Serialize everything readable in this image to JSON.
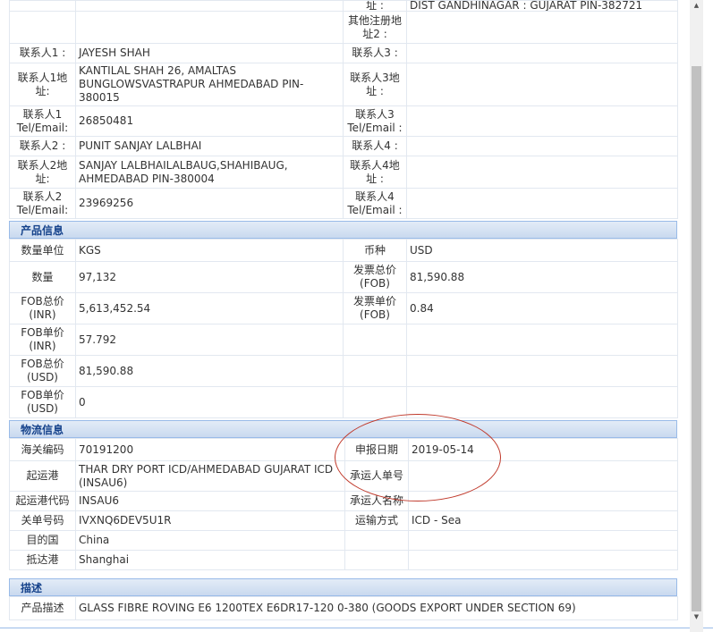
{
  "contact_section": {
    "top_row": {
      "right_label": "址 :",
      "right_value": "DIST GANDHINAGAR : GUJARAT PIN-382721"
    },
    "rows": [
      {
        "l_label": "",
        "l_value": "",
        "r_label": "其他注册地址2 :",
        "r_value": ""
      },
      {
        "l_label": "联系人1 :",
        "l_value": "JAYESH SHAH",
        "r_label": "联系人3 :",
        "r_value": ""
      },
      {
        "l_label": "联系人1地址:",
        "l_value": "KANTILAL SHAH 26, AMALTAS BUNGLOWSVASTRAPUR AHMEDABAD PIN-380015",
        "r_label": "联系人3地址 :",
        "r_value": ""
      },
      {
        "l_label": "联系人1 Tel/Email:",
        "l_value": "26850481",
        "r_label": "联系人3 Tel/Email :",
        "r_value": ""
      },
      {
        "l_label": "联系人2 :",
        "l_value": "PUNIT SANJAY LALBHAI",
        "r_label": "联系人4 :",
        "r_value": ""
      },
      {
        "l_label": "联系人2地址:",
        "l_value": "SANJAY LALBHAILALBAUG,SHAHIBAUG, AHMEDABAD PIN-380004",
        "r_label": "联系人4地址 :",
        "r_value": ""
      },
      {
        "l_label": "联系人2 Tel/Email:",
        "l_value": "23969256",
        "r_label": "联系人4 Tel/Email :",
        "r_value": ""
      }
    ]
  },
  "product_section": {
    "title": "产品信息",
    "rows": [
      {
        "l_label": "数量单位",
        "l_value": "KGS",
        "r_label": "币种",
        "r_value": "USD"
      },
      {
        "l_label": "数量",
        "l_value": "97,132",
        "r_label": "发票总价(FOB)",
        "r_value": "81,590.88"
      },
      {
        "l_label": "FOB总价(INR)",
        "l_value": "5,613,452.54",
        "r_label": "发票单价(FOB)",
        "r_value": "0.84"
      },
      {
        "l_label": "FOB单价(INR)",
        "l_value": "57.792",
        "r_label": "",
        "r_value": ""
      },
      {
        "l_label": "FOB总价(USD)",
        "l_value": "81,590.88",
        "r_label": "",
        "r_value": ""
      },
      {
        "l_label": "FOB单价(USD)",
        "l_value": "0",
        "r_label": "",
        "r_value": ""
      }
    ]
  },
  "logistics_section": {
    "title": "物流信息",
    "rows": [
      {
        "l_label": "海关编码",
        "l_value": "70191200",
        "r_label": "申报日期",
        "r_value": "2019-05-14"
      },
      {
        "l_label": "起运港",
        "l_value": "THAR DRY PORT ICD/AHMEDABAD GUJARAT ICD (INSAU6)",
        "r_label": "承运人单号",
        "r_value": ""
      },
      {
        "l_label": "起运港代码",
        "l_value": "INSAU6",
        "r_label": "承运人名称",
        "r_value": ""
      },
      {
        "l_label": "关单号码",
        "l_value": "IVXNQ6DEV5U1R",
        "r_label": "运输方式",
        "r_value": "ICD - Sea"
      },
      {
        "l_label": "目的国",
        "l_value": "China",
        "r_label": "",
        "r_value": ""
      },
      {
        "l_label": "抵达港",
        "l_value": "Shanghai",
        "r_label": "",
        "r_value": ""
      }
    ]
  },
  "description_section": {
    "title": "描述",
    "label": "产品描述",
    "value": "GLASS FIBRE ROVING E6 1200TEX E6DR17-120 0-380 (GOODS EXPORT UNDER SECTION 69)"
  },
  "annotation": {
    "color": "#c0392b"
  },
  "scrollbar": {
    "up_icon": "chevron-up-icon",
    "down_icon": "chevron-down-icon"
  }
}
